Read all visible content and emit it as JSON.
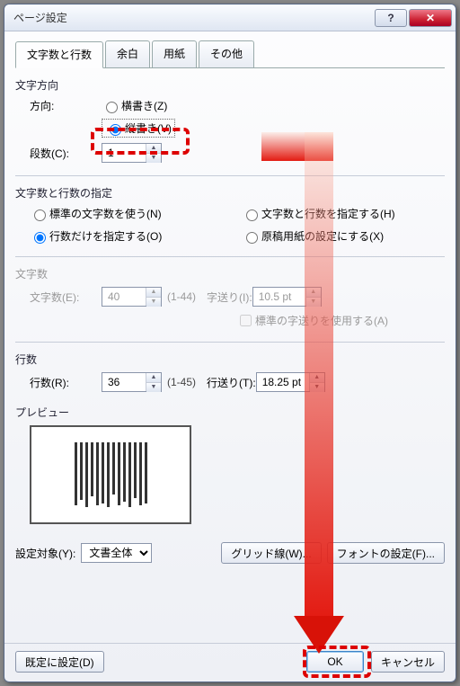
{
  "window": {
    "title": "ページ設定"
  },
  "tabs": [
    "文字数と行数",
    "余白",
    "用紙",
    "その他"
  ],
  "active_tab": 0,
  "direction": {
    "section": "文字方向",
    "label": "方向:",
    "horizontal": "横書き(Z)",
    "vertical": "縦書き(V)",
    "columns_label": "段数(C):",
    "columns_value": "1"
  },
  "charlines": {
    "section": "文字数と行数の指定",
    "opt_std": "標準の文字数を使う(N)",
    "opt_both": "文字数と行数を指定する(H)",
    "opt_lines": "行数だけを指定する(O)",
    "opt_grid": "原稿用紙の設定にする(X)"
  },
  "chars": {
    "section": "文字数",
    "count_label": "文字数(E):",
    "count_value": "40",
    "count_range": "(1-44)",
    "pitch_label": "字送り(I):",
    "pitch_value": "10.5 pt",
    "std_pitch": "標準の字送りを使用する(A)"
  },
  "lines": {
    "section": "行数",
    "count_label": "行数(R):",
    "count_value": "36",
    "count_range": "(1-45)",
    "pitch_label": "行送り(T):",
    "pitch_value": "18.25 pt"
  },
  "preview": {
    "section": "プレビュー"
  },
  "apply": {
    "label": "設定対象(Y):",
    "value": "文書全体",
    "grid_btn": "グリッド線(W)...",
    "font_btn": "フォントの設定(F)..."
  },
  "buttons": {
    "default": "既定に設定(D)",
    "ok": "OK",
    "cancel": "キャンセル"
  }
}
